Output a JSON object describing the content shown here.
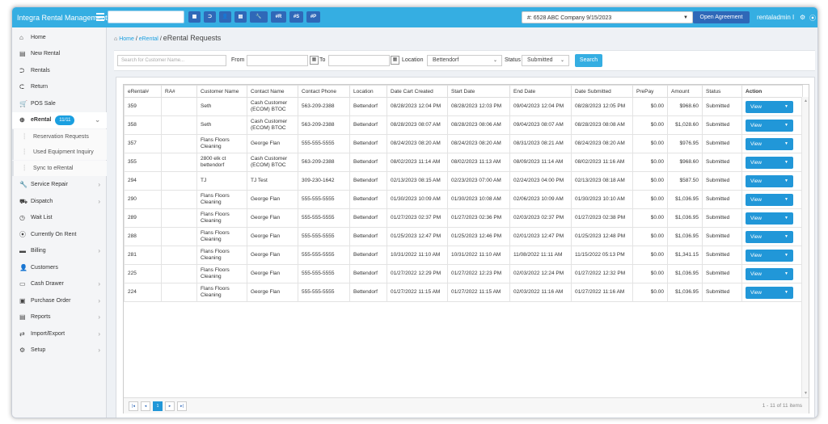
{
  "app": {
    "brand": "Integra Rental Management",
    "toolbar_buttons": [
      {
        "icon": "grid-icon",
        "label": "▦"
      },
      {
        "icon": "login-icon",
        "label": "⮊"
      },
      {
        "icon": "user-icon",
        "label": "👤"
      },
      {
        "icon": "list-icon",
        "label": "▤"
      },
      {
        "icon": "wrench-icon",
        "label": "🔧"
      },
      {
        "label": "#R"
      },
      {
        "label": "#S"
      },
      {
        "label": "#P"
      }
    ],
    "company_select": "#: 6528 ABC Company 9/15/2023",
    "open_agreement": "Open Agreement",
    "username": "rentaladmin I",
    "user_caret": "▾"
  },
  "sidebar": {
    "items": [
      {
        "icon": "home-icon",
        "glyph": "⌂",
        "label": "Home"
      },
      {
        "icon": "new-rental-icon",
        "glyph": "▤",
        "label": "New Rental"
      },
      {
        "icon": "rentals-icon",
        "glyph": "⮊",
        "label": "Rentals"
      },
      {
        "icon": "return-icon",
        "glyph": "⮈",
        "label": "Return"
      },
      {
        "icon": "cart-icon",
        "glyph": "🛒",
        "label": "POS Sale"
      },
      {
        "icon": "globe-icon",
        "glyph": "⊕",
        "label": "eRental",
        "badge": "11/11"
      },
      {
        "label": "Reservation Requests"
      },
      {
        "label": "Used Equipment Inquiry"
      },
      {
        "label": "Sync to eRental"
      },
      {
        "icon": "wrench-icon",
        "glyph": "🔧",
        "label": "Service Repair"
      },
      {
        "icon": "truck-icon",
        "glyph": "⛟",
        "label": "Dispatch"
      },
      {
        "icon": "clock-icon",
        "glyph": "◷",
        "label": "Wait List"
      },
      {
        "icon": "map-pin-icon",
        "glyph": "⦿",
        "label": "Currently On Rent"
      },
      {
        "icon": "billing-icon",
        "glyph": "▬",
        "label": "Billing"
      },
      {
        "icon": "customers-icon",
        "glyph": "👤",
        "label": "Customers"
      },
      {
        "icon": "cash-drawer-icon",
        "glyph": "▭",
        "label": "Cash Drawer"
      },
      {
        "icon": "purchase-order-icon",
        "glyph": "▣",
        "label": "Purchase Order"
      },
      {
        "icon": "reports-icon",
        "glyph": "▤",
        "label": "Reports"
      },
      {
        "icon": "import-export-icon",
        "glyph": "⇄",
        "label": "Import/Export"
      },
      {
        "icon": "setup-gear-icon",
        "glyph": "⚙",
        "label": "Setup"
      }
    ]
  },
  "breadcrumb": {
    "home": "Home",
    "sep1": "/",
    "erental": "eRental",
    "sep2": "/",
    "current": "eRental Requests"
  },
  "filters": {
    "search_placeholder": "Search for Customer Name...",
    "from_label": "From",
    "to_label": "To",
    "location_label": "Location",
    "location_value": "Bettendorf",
    "status_label": "Status",
    "status_value": "Submitted",
    "search_button": "Search"
  },
  "table": {
    "headers": [
      "eRental#",
      "RA#",
      "Customer Name",
      "Contact Name",
      "Contact Phone",
      "Location",
      "Date Cart Created",
      "Start Date",
      "End Date",
      "Date Submitted",
      "PrePay",
      "Amount",
      "Status",
      "Action"
    ],
    "rows": [
      [
        "359",
        "",
        "Seth",
        "Cash Customer (ECOM) BTOC",
        "563-209-2388",
        "Bettendorf",
        "08/28/2023 12:04 PM",
        "08/28/2023 12:03 PM",
        "09/04/2023 12:04 PM",
        "08/28/2023 12:05 PM",
        "$0.00",
        "$968.60",
        "Submitted",
        "View"
      ],
      [
        "358",
        "",
        "Seth",
        "Cash Customer (ECOM) BTOC",
        "563-209-2388",
        "Bettendorf",
        "08/28/2023 08:07 AM",
        "08/28/2023 08:06 AM",
        "09/04/2023 08:07 AM",
        "08/28/2023 08:08 AM",
        "$0.00",
        "$1,028.60",
        "Submitted",
        "View"
      ],
      [
        "357",
        "",
        "Flans Floors Cleaning",
        "George Flan",
        "555-555-5555",
        "Bettendorf",
        "08/24/2023 08:20 AM",
        "08/24/2023 08:20 AM",
        "08/31/2023 08:21 AM",
        "08/24/2023 08:20 AM",
        "$0.00",
        "$976.95",
        "Submitted",
        "View"
      ],
      [
        "355",
        "",
        "2800 elk ct bettendorf",
        "Cash Customer (ECOM) BTOC",
        "563-209-2388",
        "Bettendorf",
        "08/02/2023 11:14 AM",
        "08/02/2023 11:13 AM",
        "08/09/2023 11:14 AM",
        "08/02/2023 11:16 AM",
        "$0.00",
        "$968.60",
        "Submitted",
        "View"
      ],
      [
        "294",
        "",
        "TJ",
        "TJ Test",
        "309-230-1642",
        "Bettendorf",
        "02/13/2023 08:15 AM",
        "02/23/2023 07:00 AM",
        "02/24/2023 04:00 PM",
        "02/13/2023 08:18 AM",
        "$0.00",
        "$587.50",
        "Submitted",
        "View"
      ],
      [
        "290",
        "",
        "Flans Floors Cleaning",
        "George Flan",
        "555-555-5555",
        "Bettendorf",
        "01/30/2023 10:09 AM",
        "01/30/2023 10:08 AM",
        "02/06/2023 10:09 AM",
        "01/30/2023 10:10 AM",
        "$0.00",
        "$1,036.95",
        "Submitted",
        "View"
      ],
      [
        "289",
        "",
        "Flans Floors Cleaning",
        "George Flan",
        "555-555-5555",
        "Bettendorf",
        "01/27/2023 02:37 PM",
        "01/27/2023 02:36 PM",
        "02/03/2023 02:37 PM",
        "01/27/2023 02:38 PM",
        "$0.00",
        "$1,036.95",
        "Submitted",
        "View"
      ],
      [
        "288",
        "",
        "Flans Floors Cleaning",
        "George Flan",
        "555-555-5555",
        "Bettendorf",
        "01/25/2023 12:47 PM",
        "01/25/2023 12:46 PM",
        "02/01/2023 12:47 PM",
        "01/25/2023 12:48 PM",
        "$0.00",
        "$1,036.95",
        "Submitted",
        "View"
      ],
      [
        "281",
        "",
        "Flans Floors Cleaning",
        "George Flan",
        "555-555-5555",
        "Bettendorf",
        "10/31/2022 11:10 AM",
        "10/31/2022 11:10 AM",
        "11/08/2022 11:11 AM",
        "11/15/2022 05:13 PM",
        "$0.00",
        "$1,341.15",
        "Submitted",
        "View"
      ],
      [
        "225",
        "",
        "Flans Floors Cleaning",
        "George Flan",
        "555-555-5555",
        "Bettendorf",
        "01/27/2022 12:29 PM",
        "01/27/2022 12:23 PM",
        "02/03/2022 12:24 PM",
        "01/27/2022 12:32 PM",
        "$0.00",
        "$1,036.95",
        "Submitted",
        "View"
      ],
      [
        "224",
        "",
        "Flans Floors Cleaning",
        "George Flan",
        "555-555-5555",
        "Bettendorf",
        "01/27/2022 11:15 AM",
        "01/27/2022 11:15 AM",
        "02/03/2022 11:16 AM",
        "01/27/2022 11:16 AM",
        "$0.00",
        "$1,036.95",
        "Submitted",
        "View"
      ]
    ]
  },
  "pager": {
    "first": "|◂",
    "prev": "◂",
    "page": "1",
    "next": "▸",
    "last": "▸|",
    "info": "1 - 11 of 11 items"
  },
  "colors": {
    "topbar": "#35aee2",
    "accent": "#2197d8",
    "button_dark": "#2f68b8",
    "badge": "#1a9fe0"
  }
}
